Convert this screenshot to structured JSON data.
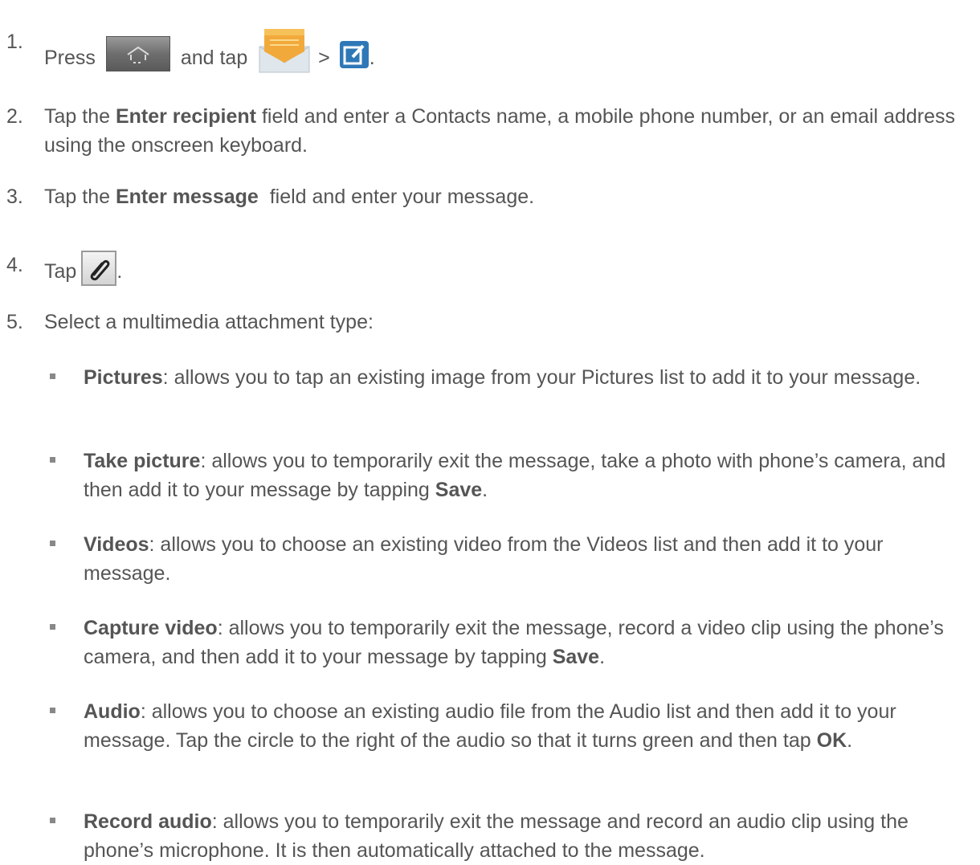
{
  "steps": [
    {
      "num": "1.",
      "parts": [
        "Press",
        "and tap",
        ">",
        "."
      ],
      "icons": [
        "home-key-icon",
        "messaging-envelope-icon",
        "compose-icon"
      ]
    },
    {
      "num": "2.",
      "pre": "Tap the ",
      "bold": "Enter recipient",
      "post": " field and enter a Contacts name, a mobile phone number, or an email address using the onscreen keyboard."
    },
    {
      "num": "3.",
      "pre": "Tap the ",
      "bold": "Enter message",
      "post": "  field and enter your message."
    },
    {
      "num": "4.",
      "pre": "Tap",
      "post": ".",
      "icon": "paperclip-attach-icon"
    },
    {
      "num": "5.",
      "text": "Select a multimedia attachment type:"
    }
  ],
  "attachment_types": [
    {
      "label": "Pictures",
      "desc": ": allows you to tap an existing image from your Pictures list to add it to your message."
    },
    {
      "label": "Take picture",
      "desc": ": allows you to temporarily exit the message, take a photo with phone’s camera, and then add it to your message by tapping ",
      "bold2": "Save",
      "end": "."
    },
    {
      "label": "Videos",
      "desc": ": allows you to choose an existing video from the Videos list and then add it to your message."
    },
    {
      "label": "Capture video",
      "desc": ": allows you to temporarily exit the message, record a video clip using the phone’s camera, and then add it to your message by tapping ",
      "bold2": "Save",
      "end": "."
    },
    {
      "label": "Audio",
      "desc": ": allows you to choose an existing audio file from the Audio list and then add it to your message. Tap the circle to the right of the audio so that it turns green and then tap ",
      "bold2": "OK",
      "end": "."
    },
    {
      "label": "Record audio",
      "desc": ": allows you to temporarily exit the message and record an audio clip using the phone’s microphone. It is then automatically attached to the message."
    }
  ],
  "colors": {
    "text": "#555555",
    "envelope_orange": "#f2a93b",
    "compose_blue": "#2f78b7"
  }
}
